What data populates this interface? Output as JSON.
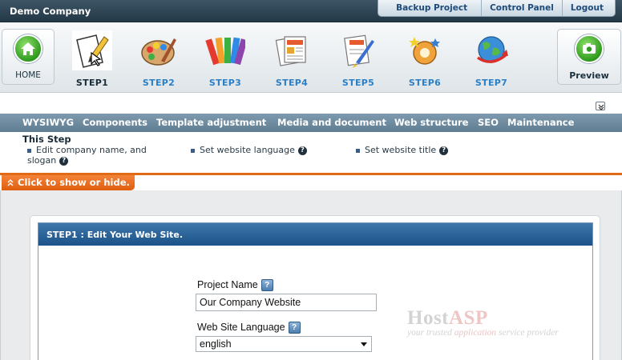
{
  "header": {
    "company": "Demo Company",
    "links": [
      "Backup Project",
      "Control Panel",
      "Logout"
    ]
  },
  "stepbar": {
    "home_label": "HOME",
    "preview_label": "Preview",
    "steps": [
      "STEP1",
      "STEP2",
      "STEP3",
      "STEP4",
      "STEP5",
      "STEP6",
      "STEP7"
    ],
    "active_step": "STEP1"
  },
  "tabs": [
    "WYSIWYG",
    "Components",
    "Template adjustment",
    "Media and document",
    "Web structure",
    "SEO",
    "Maintenance"
  ],
  "this_step": {
    "title": "This Step",
    "tasks": [
      "Edit company name, and slogan",
      "Set website language",
      "Set website title"
    ]
  },
  "toggle_label": "Click to show or hide.",
  "panel": {
    "title": "STEP1 : Edit Your Web Site.",
    "project_name_label": "Project Name",
    "project_name_value": "Our Company Website",
    "language_label": "Web Site Language",
    "language_value": "english",
    "help_glyph": "?"
  },
  "watermark": {
    "brand_a": "Host",
    "brand_b": "ASP",
    "tag_a": "your trusted ",
    "tag_b": "application",
    "tag_c": " service provider"
  },
  "colors": {
    "topbar": "#243846",
    "accent_orange": "#e06a16",
    "step_label": "#2a7fc6",
    "panel_header": "#1b5288"
  }
}
